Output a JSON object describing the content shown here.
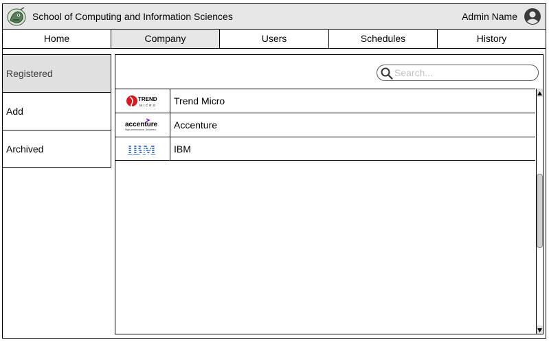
{
  "header": {
    "title": "School of Computing and Information Sciences",
    "admin_name": "Admin Name",
    "logo_icon": "school-mascot-logo",
    "avatar_icon": "user-circle-icon"
  },
  "nav": {
    "tabs": [
      {
        "label": "Home",
        "active": false
      },
      {
        "label": "Company",
        "active": true
      },
      {
        "label": "Users",
        "active": false
      },
      {
        "label": "Schedules",
        "active": false
      },
      {
        "label": "History",
        "active": false
      }
    ]
  },
  "sidebar": {
    "items": [
      {
        "label": "Registered",
        "active": true
      },
      {
        "label": "Add",
        "active": false
      },
      {
        "label": "Archived",
        "active": false
      }
    ]
  },
  "search": {
    "placeholder": "Search...",
    "value": ""
  },
  "companies": [
    {
      "name": "Trend Micro",
      "logo": "trend-micro-logo",
      "logo_text": "TREND",
      "logo_subtext": "MICRO"
    },
    {
      "name": "Accenture",
      "logo": "accenture-logo",
      "logo_text": "accenture",
      "logo_subtext": "High performance. Delivered."
    },
    {
      "name": "IBM",
      "logo": "ibm-logo",
      "logo_text": "IBM"
    }
  ],
  "colors": {
    "header_bg": "#e6e6e6",
    "active_bg": "#e0e0e0",
    "trend_red": "#d71921",
    "ibm_blue": "#4a78c8",
    "accenture_purple": "#7b00c4"
  }
}
